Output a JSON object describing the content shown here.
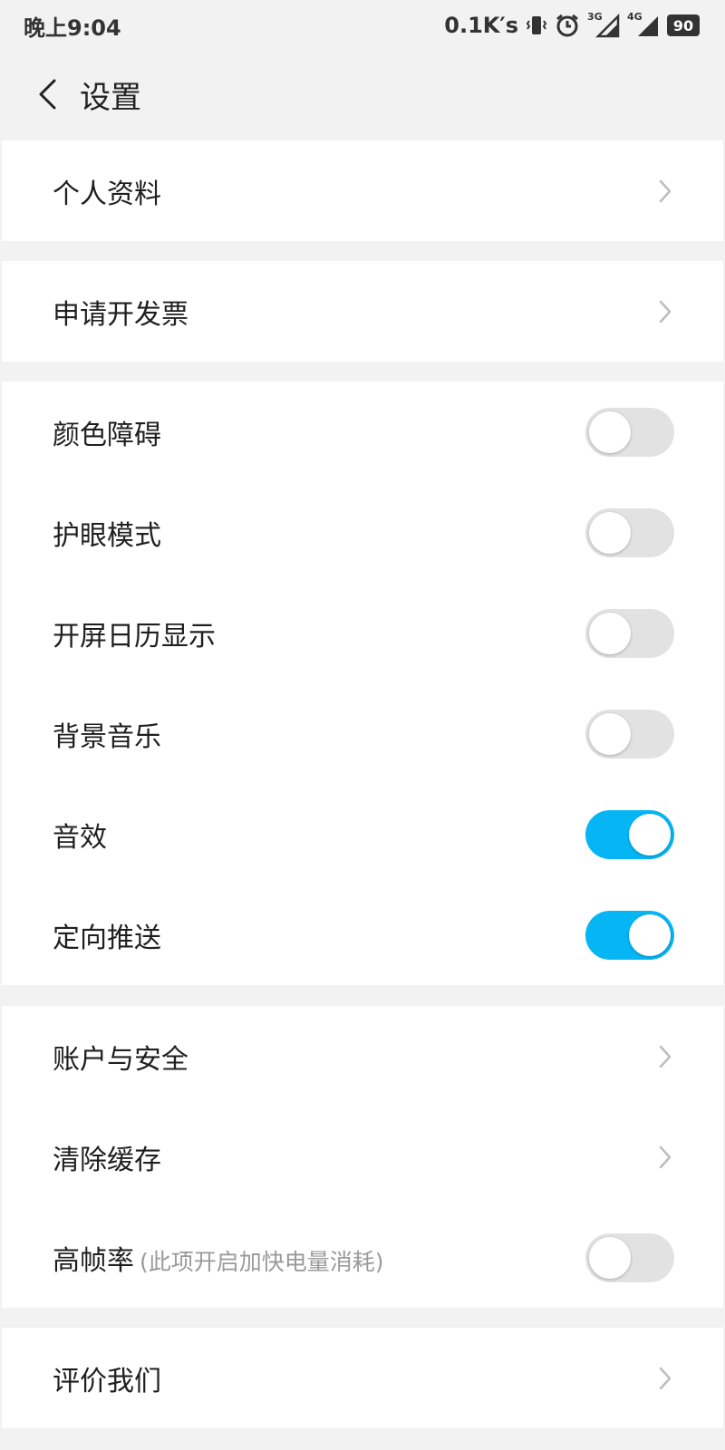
{
  "status_bar": {
    "time": "晚上9:04",
    "network_speed": "0.1K′s",
    "icons": [
      "vibrate-icon",
      "alarm-icon",
      "signal-3g-icon",
      "signal-4g-icon"
    ],
    "signal_3g_label": "3G",
    "signal_4g_label": "4G",
    "battery": "90"
  },
  "header": {
    "back_icon": "chevron-left-icon",
    "title": "设置"
  },
  "groups": {
    "profile": {
      "items": [
        {
          "label": "个人资料",
          "type": "link",
          "icon": "chevron-right-icon"
        }
      ]
    },
    "invoice": {
      "items": [
        {
          "label": "申请开发票",
          "type": "link",
          "icon": "chevron-right-icon"
        }
      ]
    },
    "toggles": {
      "items": [
        {
          "label": "颜色障碍",
          "type": "toggle",
          "on": false
        },
        {
          "label": "护眼模式",
          "type": "toggle",
          "on": false
        },
        {
          "label": "开屏日历显示",
          "type": "toggle",
          "on": false
        },
        {
          "label": "背景音乐",
          "type": "toggle",
          "on": false
        },
        {
          "label": "音效",
          "type": "toggle",
          "on": true
        },
        {
          "label": "定向推送",
          "type": "toggle",
          "on": true
        }
      ]
    },
    "account": {
      "items": [
        {
          "label": "账户与安全",
          "type": "link",
          "icon": "chevron-right-icon"
        },
        {
          "label": "清除缓存",
          "type": "link",
          "icon": "chevron-right-icon"
        },
        {
          "label": "高帧率",
          "note": "(此项开启加快电量消耗)",
          "type": "toggle",
          "on": false
        }
      ]
    },
    "rate": {
      "items": [
        {
          "label": "评价我们",
          "type": "link",
          "icon": "chevron-right-icon"
        }
      ]
    }
  },
  "colors": {
    "background": "#f2f2f2",
    "card": "#ffffff",
    "toggle_on": "#06b6f4",
    "toggle_off": "#e2e2e2",
    "chevron": "#bdbdbd"
  }
}
